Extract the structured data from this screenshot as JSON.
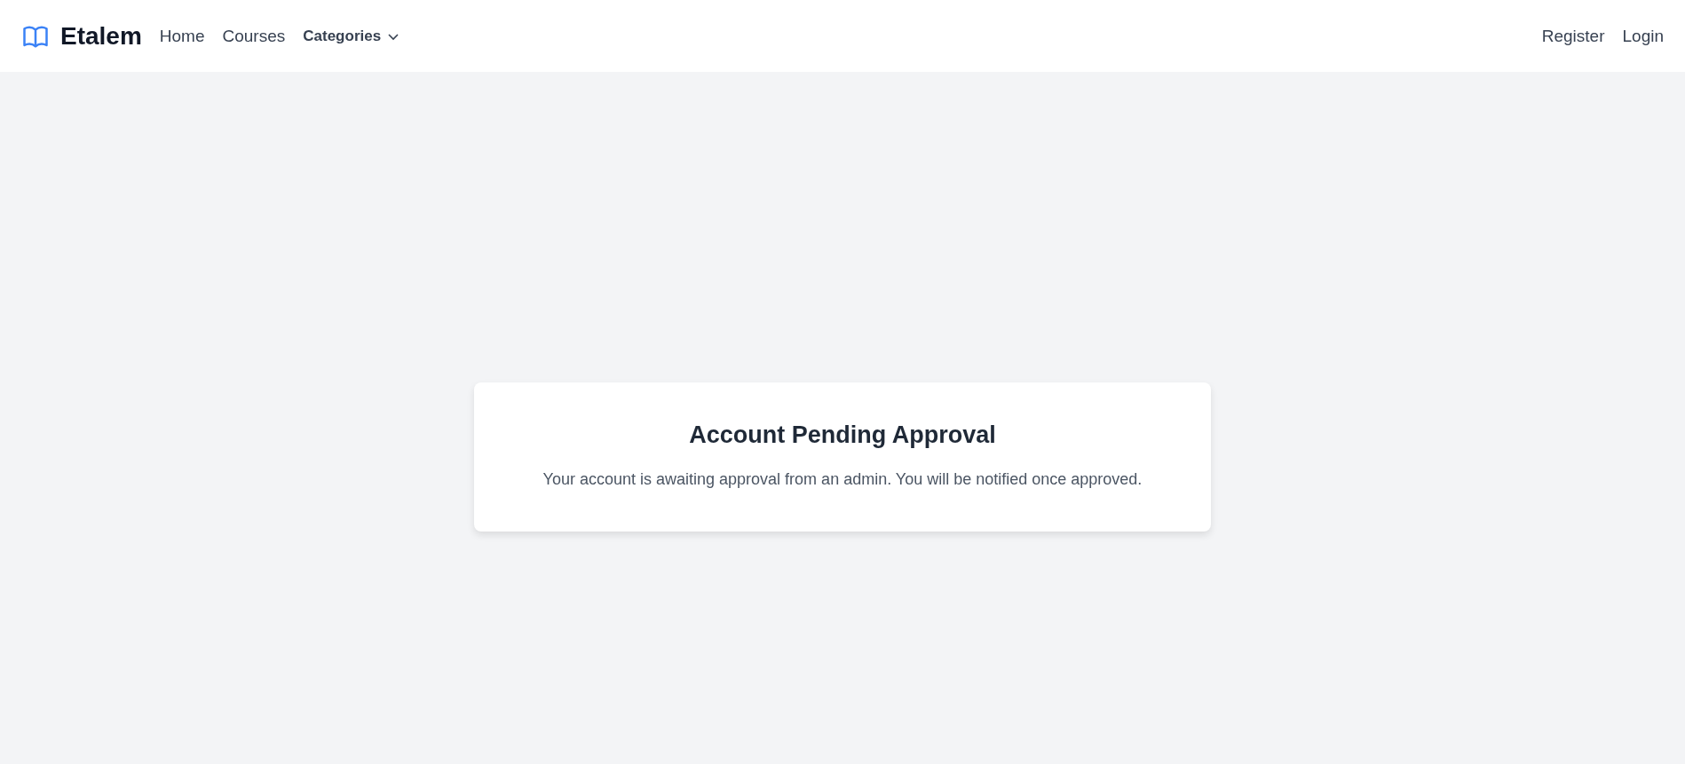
{
  "navbar": {
    "brand": "Etalem",
    "links": [
      {
        "label": "Home",
        "kind": "link"
      },
      {
        "label": "Courses",
        "kind": "link"
      },
      {
        "label": "Categories",
        "kind": "dropdown"
      }
    ],
    "auth_links": [
      "Register",
      "Login"
    ]
  },
  "card": {
    "title": "Account Pending Approval",
    "message": "Your account is awaiting approval from an admin. You will be notified once approved."
  }
}
